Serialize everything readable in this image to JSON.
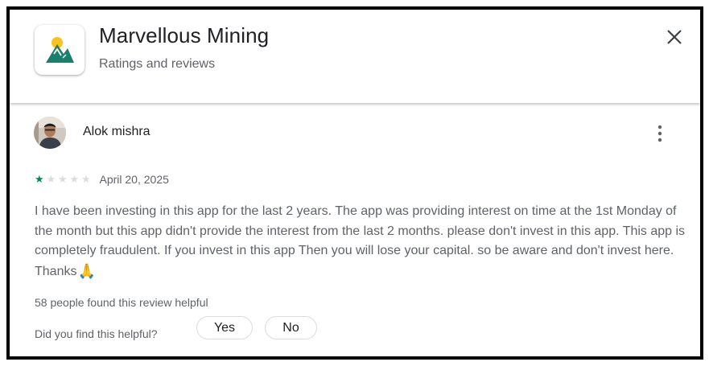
{
  "header": {
    "app_title": "Marvellous Mining",
    "subtitle": "Ratings and reviews",
    "app_icon": "mountain-logo-icon",
    "close_icon": "close-icon"
  },
  "review": {
    "reviewer_name": "Alok mishra",
    "rating": 1,
    "rating_max": 5,
    "date": "April 20, 2025",
    "text": "I have been investing in this app for the last 2 years. The app was providing interest on time at the 1st Monday of the month but this app didn't provide the interest from the last 2 months. please don't invest in this app. This app is completely fraudulent. If you invest in this app Then you will lose your capital. so be aware and don't invest here. Thanks",
    "text_emoji": "🙏",
    "helpful_count_text": "58 people found this review helpful",
    "helpful_question": "Did you find this helpful?",
    "yes_label": "Yes",
    "no_label": "No",
    "more_icon": "more-vertical-icon"
  },
  "colors": {
    "star_filled": "#01875f",
    "star_empty": "#dadce0",
    "secondary_text": "#5f6368",
    "primary_text": "#202124",
    "icon_green": "#1a7f6d",
    "icon_sun": "#f7c31c"
  }
}
